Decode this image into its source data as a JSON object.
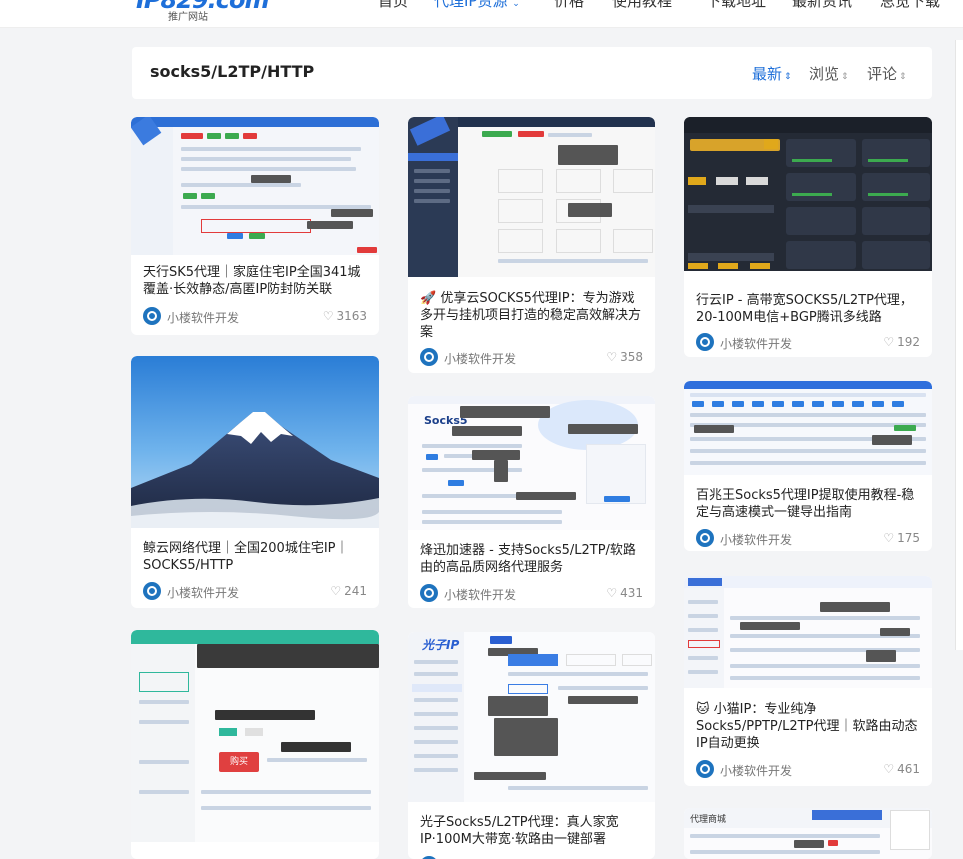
{
  "logo": {
    "main": "IP829.com",
    "sub": "推广网站"
  },
  "nav": [
    {
      "label": "首页"
    },
    {
      "label": "代理IP资源",
      "active": true
    },
    {
      "label": "价格"
    },
    {
      "label": "使用教程"
    },
    {
      "label": "下载地址"
    },
    {
      "label": "最新资讯"
    },
    {
      "label": "总览下载"
    }
  ],
  "header": {
    "title": "socks5/L2TP/HTTP",
    "sort": [
      {
        "label": "最新",
        "active": true
      },
      {
        "label": "浏览"
      },
      {
        "label": "评论"
      }
    ]
  },
  "cards": [
    {
      "title": "天行SK5代理｜家庭住宅IP全国341城覆盖·长效静态/高匿IP防封防关联",
      "author": "小楼软件开发",
      "likes": "3163"
    },
    {
      "title": "🚀 优享云SOCKS5代理IP：专为游戏多开与挂机项目打造的稳定高效解决方案",
      "author": "小楼软件开发",
      "likes": "358"
    },
    {
      "title": "行云IP - 高带宽SOCKS5/L2TP代理，20-100M电信+BGP腾讯多线路",
      "author": "小楼软件开发",
      "likes": "192"
    },
    {
      "title": "鲸云网络代理｜全国200城住宅IP｜SOCKS5/HTTP",
      "author": "小楼软件开发",
      "likes": "241"
    },
    {
      "title": "烽迅加速器 - 支持Socks5/L2TP/软路由的高品质网络代理服务",
      "author": "小楼软件开发",
      "likes": "431"
    },
    {
      "title": "百兆王Socks5代理IP提取使用教程-稳定与高速模式一键导出指南",
      "author": "小楼软件开发",
      "likes": "175"
    },
    {
      "title": "光子Socks5/L2TP代理：真人家宽IP·100M大带宽·软路由一键部署",
      "author": "",
      "likes": ""
    },
    {
      "title": "🐱 小猫IP：专业纯净Socks5/PPTP/L2TP代理｜软路由动态IP自动更换",
      "author": "小楼软件开发",
      "likes": "461"
    },
    {
      "title": "",
      "author": "",
      "likes": ""
    }
  ],
  "thumb_text": {
    "socks5": "Socks5",
    "guangzi": "光子IP",
    "buy": "购买",
    "daili": "代理商城"
  },
  "colors": {
    "accent": "#1e6fd9",
    "author_icon": "#1e73be"
  }
}
